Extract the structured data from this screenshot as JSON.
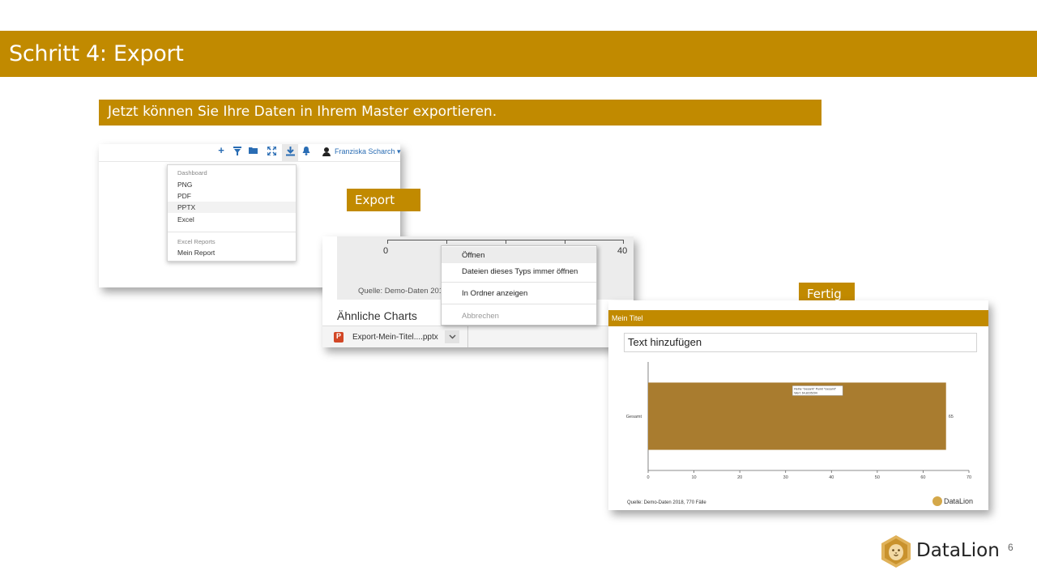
{
  "slide": {
    "title": "Schritt 4: Export",
    "subtitle": "Jetzt können Sie Ihre Daten in Ihrem Master exportieren.",
    "page_number": "6",
    "accent_color": "#c18a00",
    "logo_text": "DataLion"
  },
  "labels": {
    "export": "Export",
    "done": "Fertig"
  },
  "dashboard_shot": {
    "toolbar_icons": [
      "plus-icon",
      "filter-icon",
      "folder-icon",
      "expand-icon",
      "download-icon",
      "bell-icon",
      "user-icon"
    ],
    "user_name": "Franziska Scharch ▾",
    "menu": {
      "section1": "Dashboard",
      "items1": [
        "PNG",
        "PDF",
        "PPTX",
        "Excel"
      ],
      "selected": "PPTX",
      "section2": "Excel Reports",
      "items2": [
        "Mein Report"
      ]
    }
  },
  "download_shot": {
    "axis_ticks": [
      "0",
      "40"
    ],
    "source": "Quelle: Demo-Daten 2018, n=",
    "similar_heading": "Ähnliche Charts",
    "download_file": "Export-Mein-Titel....pptx",
    "context_menu": [
      "Öffnen",
      "Dateien dieses Typs immer öffnen",
      "In Ordner anzeigen",
      "Abbrechen"
    ],
    "context_highlighted": "Öffnen",
    "context_disabled": "Abbrechen"
  },
  "result_shot": {
    "title": "Mein Titel",
    "text_box": "Text hinzufügen",
    "source": "Quelle: Demo-Daten 2018, 770 Fälle",
    "logo_text": "DataLion",
    "tooltip_line1": "Reihe \"Gesamt\" Punkt \"Gesamt\"",
    "tooltip_line2": "Wert: 64,8235294"
  },
  "chart_data": {
    "type": "bar",
    "orientation": "horizontal",
    "categories": [
      "Gesamt"
    ],
    "values": [
      65
    ],
    "value_labels": [
      "65"
    ],
    "xlim": [
      0,
      70
    ],
    "x_ticks": [
      0,
      10,
      20,
      30,
      40,
      50,
      60,
      70
    ],
    "bar_color": "#a97c2f",
    "grid": false
  }
}
